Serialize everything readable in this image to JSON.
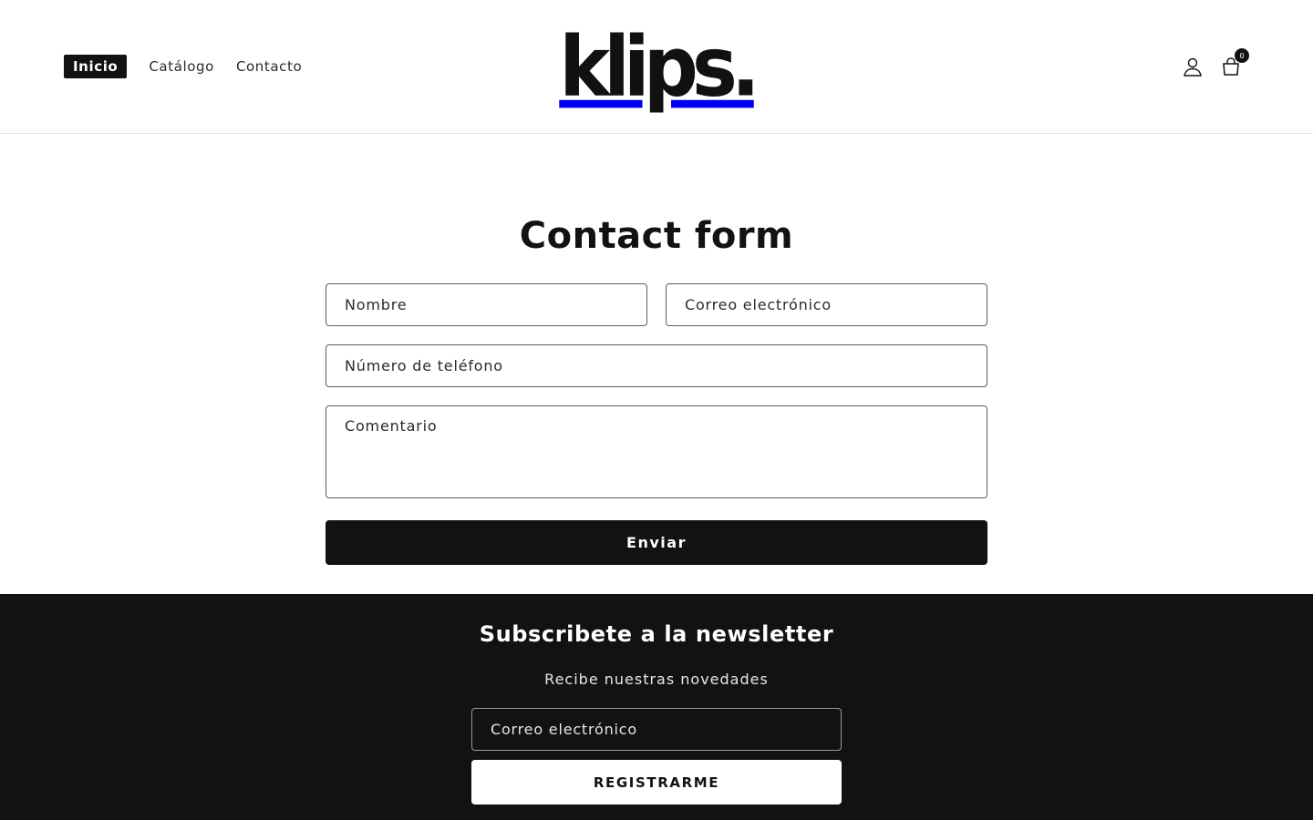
{
  "header": {
    "nav": [
      {
        "label": "Inicio",
        "active": true
      },
      {
        "label": "Catálogo",
        "active": false
      },
      {
        "label": "Contacto",
        "active": false
      }
    ],
    "logo_text": "klips.",
    "cart_count": "0",
    "icons": {
      "account": "user-icon",
      "cart": "shopping-bag-icon"
    }
  },
  "contact": {
    "title": "Contact form",
    "name_placeholder": "Nombre",
    "email_placeholder": "Correo electrónico",
    "phone_placeholder": "Número de teléfono",
    "comment_placeholder": "Comentario",
    "submit_label": "Enviar"
  },
  "newsletter": {
    "title": "Subscribete a la newsletter",
    "subtitle": "Recibe nuestras novedades",
    "email_placeholder": "Correo electrónico",
    "button_label": "REGISTRARME"
  },
  "colors": {
    "primary": "#121212",
    "background": "#ffffff",
    "footer_bg": "#121212"
  }
}
